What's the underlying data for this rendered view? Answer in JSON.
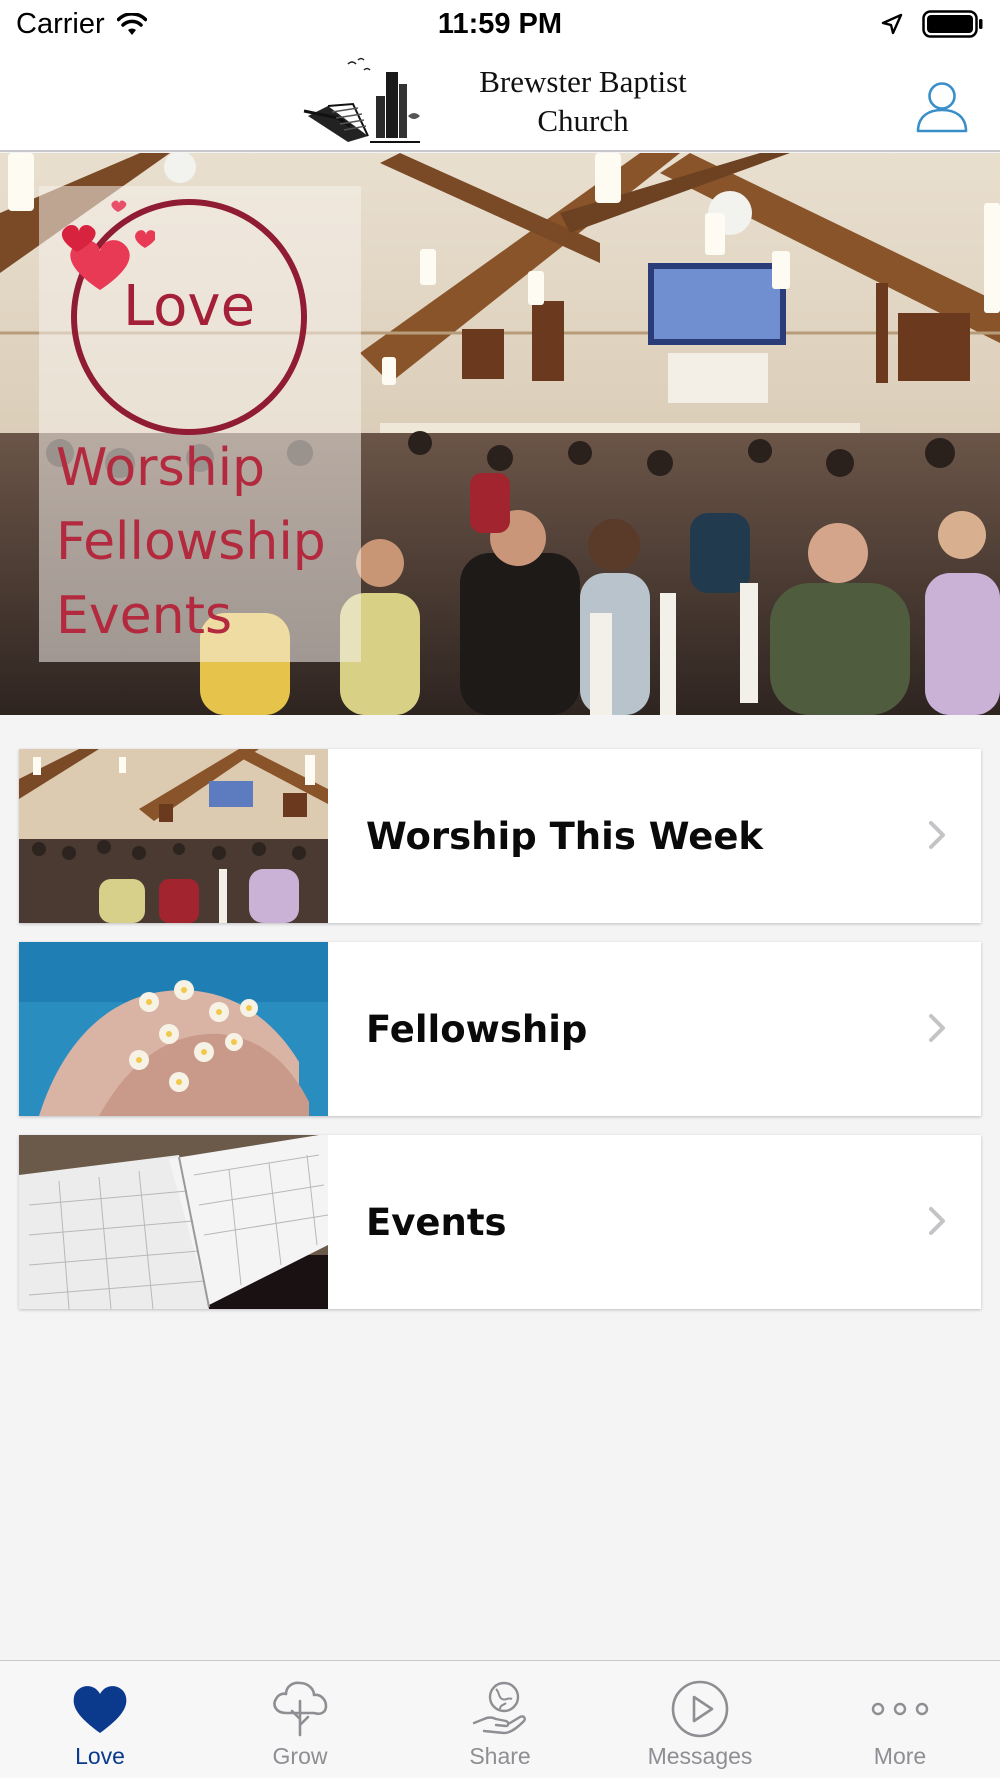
{
  "status_bar": {
    "carrier": "Carrier",
    "time": "11:59 PM"
  },
  "header": {
    "church_name": "Brewster Baptist Church",
    "church_name_line1": "Brewster Baptist",
    "church_name_line2": "Church"
  },
  "hero": {
    "badge_title": "Love",
    "badge_lines": [
      "Worship",
      "Fellowship",
      "Events"
    ],
    "badge_color": "#a32038"
  },
  "cards": [
    {
      "label": "Worship This Week",
      "image": "congregation-photo"
    },
    {
      "label": "Fellowship",
      "image": "flowers-in-hands-photo"
    },
    {
      "label": "Events",
      "image": "calendar-planner-photo"
    }
  ],
  "tabs": [
    {
      "label": "Love",
      "icon": "heart-icon",
      "active": true
    },
    {
      "label": "Grow",
      "icon": "tree-icon",
      "active": false
    },
    {
      "label": "Share",
      "icon": "globe-hand-icon",
      "active": false
    },
    {
      "label": "Messages",
      "icon": "play-icon",
      "active": false
    },
    {
      "label": "More",
      "icon": "more-dots-icon",
      "active": false
    }
  ],
  "colors": {
    "active_tab": "#0b3a8c",
    "inactive_tab": "#8e8e93",
    "profile_icon": "#3a8fc9"
  }
}
